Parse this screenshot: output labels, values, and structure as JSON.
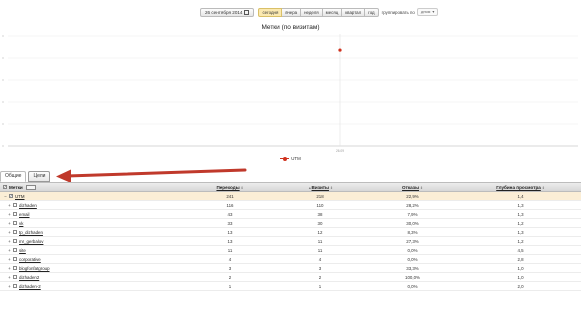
{
  "toolbar": {
    "date_range": "26 сентября 2014",
    "periods": [
      "сегодня",
      "вчера",
      "неделя",
      "месяц",
      "квартал",
      "год"
    ],
    "active_period": 0,
    "group_label": "группировать по",
    "group_value": "дням"
  },
  "chart": {
    "title": "Метки (по визитам)",
    "legend": "UTM",
    "x_tick": "26.09",
    "color": "#d0321e"
  },
  "chart_data": {
    "type": "line",
    "title": "Метки (по визитам)",
    "x": [
      "26.09"
    ],
    "series": [
      {
        "name": "UTM",
        "values": [
          218
        ]
      }
    ],
    "grid": true,
    "legend_position": "bottom"
  },
  "tabs": [
    {
      "label": "Общие",
      "active": true
    },
    {
      "label": "Цели",
      "active": false
    }
  ],
  "table": {
    "headers": {
      "name": "Метки",
      "c1": "Переходы",
      "c2": "Визиты",
      "c3": "Отказы",
      "c4": "Глубина просмотра"
    },
    "total": {
      "name": "UTM",
      "c1": "241",
      "c2": "218",
      "c3": "22,9%",
      "c4": "1,4"
    },
    "rows": [
      {
        "name": "dizhaden",
        "c1": "116",
        "c2": "110",
        "c3": "28,2%",
        "c4": "1,3"
      },
      {
        "name": "email",
        "c1": "43",
        "c2": "38",
        "c3": "7,9%",
        "c4": "1,3"
      },
      {
        "name": "vk",
        "c1": "33",
        "c2": "30",
        "c3": "30,0%",
        "c4": "1,2"
      },
      {
        "name": "tp_dizhaden",
        "c1": "13",
        "c2": "12",
        "c3": "8,3%",
        "c4": "1,3"
      },
      {
        "name": "mr_gerbalov",
        "c1": "13",
        "c2": "11",
        "c3": "27,3%",
        "c4": "1,2"
      },
      {
        "name": "site",
        "c1": "11",
        "c2": "11",
        "c3": "0,0%",
        "c4": "4,5"
      },
      {
        "name": "corporative",
        "c1": "4",
        "c2": "4",
        "c3": "0,0%",
        "c4": "2,8"
      },
      {
        "name": "blogfonfatgroup",
        "c1": "3",
        "c2": "3",
        "c3": "33,3%",
        "c4": "1,0"
      },
      {
        "name": "dizhaden2",
        "c1": "2",
        "c2": "2",
        "c3": "100,0%",
        "c4": "1,0"
      },
      {
        "name": "dizhaden-2",
        "c1": "1",
        "c2": "1",
        "c3": "0,0%",
        "c4": "2,0"
      }
    ]
  }
}
